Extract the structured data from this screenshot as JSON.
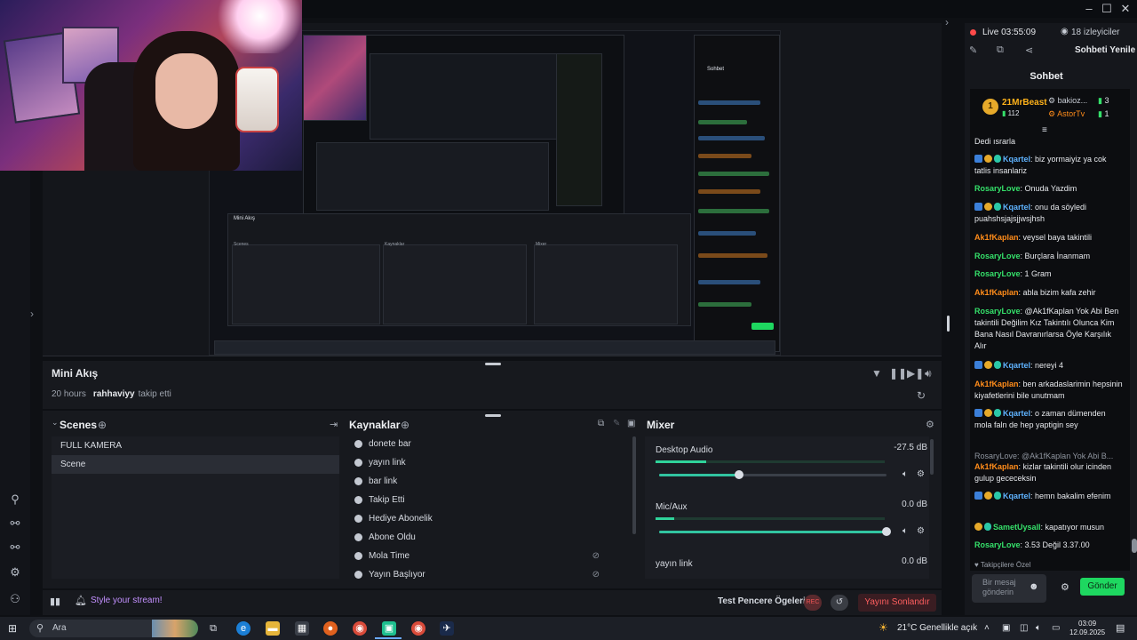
{
  "top": {
    "nav_arrow": "›",
    "win_buttons": [
      "–",
      "☐",
      "✕"
    ]
  },
  "left_rail_icons": [
    "chart-icon",
    "bell-icon",
    "link-icon",
    "link2-icon",
    "settings-icon",
    "user-icon"
  ],
  "mini_akis": {
    "title": "Mini Akış",
    "time": "20 hours",
    "user": "rahhaviyy",
    "event": "takip etti"
  },
  "scenes": {
    "title": "Scenes",
    "items": [
      "FULL KAMERA",
      "Scene"
    ],
    "selected_index": 1
  },
  "sources": {
    "title": "Kaynaklar",
    "items": [
      "donete bar",
      "yayın link",
      "bar link",
      "Takip Etti",
      "Hediye Abonelik",
      "Abone Oldu",
      "Mola Time",
      "Yayın Başlıyor"
    ],
    "hidden_indices": [
      6,
      7
    ]
  },
  "mixer": {
    "title": "Mixer",
    "channels": [
      {
        "name": "Desktop Audio",
        "db": "-27.5 dB",
        "level": 0.22,
        "volume": 0.35
      },
      {
        "name": "Mic/Aux",
        "db": "0.0 dB",
        "level": 0.08,
        "volume": 1.0
      },
      {
        "name": "yayın link",
        "db": "0.0 dB",
        "level": 0,
        "volume": 1.0
      }
    ]
  },
  "footer": {
    "style_label": "Style your stream!",
    "test_label": "Test Pencere Ögeleri",
    "rec_label": "REC",
    "end_label": "Yayını Sonlandır"
  },
  "stream": {
    "live_label": "Live 03:55:09",
    "viewers": "18 izleyiciler",
    "refresh_chat": "Sohbeti Yenile"
  },
  "chat": {
    "title": "Sohbet",
    "leaderboard": {
      "top_name": "21MrBeast",
      "top_badge": "1",
      "top_count": "112",
      "second_name": "bakioz...",
      "second_count": "3",
      "third_name": "AstorTv",
      "third_count": "1"
    },
    "colors": {
      "blue": "#5fb3ff",
      "green": "#35e06a",
      "orange": "#ff8c1a",
      "gray": "#8e949e"
    },
    "messages": [
      {
        "user": "",
        "text": "Dedi ısrarla",
        "color": "white",
        "badges": false
      },
      {
        "user": "Kqartel",
        "text": ": biz yormaiyiz ya cok tatlis insanlariz",
        "color": "blue",
        "badges": true
      },
      {
        "user": "RosaryLove",
        "text": ": Onuda Yazdim",
        "color": "green",
        "badges": false
      },
      {
        "user": "Kqartel",
        "text": ": onu da söyledi puahshsjajsjjwsjhsh",
        "color": "blue",
        "badges": true
      },
      {
        "user": "Ak1fKaplan",
        "text": ": veysel baya takintili",
        "color": "orange",
        "badges": false
      },
      {
        "user": "RosaryLove",
        "text": ": Burçlara İnanmam",
        "color": "green",
        "badges": false
      },
      {
        "user": "RosaryLove",
        "text": ": 1 Gram",
        "color": "green",
        "badges": false
      },
      {
        "user": "Ak1fKaplan",
        "text": ": abla bizim kafa zehir",
        "color": "orange",
        "badges": false
      },
      {
        "user": "RosaryLove",
        "text": ": @Ak1fKaplan Yok Abi Ben takintili Değilim Kız Takintılı Olunca Kim Bana Nasıl Davranırlarsa Öyle Karşılık Alır",
        "color": "green",
        "badges": false
      },
      {
        "user": "Kqartel",
        "text": ": nereyi 4",
        "color": "blue",
        "badges": true
      },
      {
        "user": "Ak1fKaplan",
        "text": ": ben arkadaslarimin hepsinin kiyafetlerini bile unutmam",
        "color": "orange",
        "badges": false
      },
      {
        "user": "Kqartel",
        "text": ": o zaman dümenden mola faln de hep yaptigin sey",
        "color": "blue",
        "badges": true
      },
      {
        "user": "",
        "text": "RosaryLove: @Ak1fKaplan Yok Abi B...",
        "color": "gray",
        "badges": false
      },
      {
        "user": "Ak1fKaplan",
        "text": ": kizlar takintili olur icinden gulup gececeksin",
        "color": "orange",
        "badges": false
      },
      {
        "user": "Kqartel",
        "text": ": hemn bakalim efenim",
        "color": "blue",
        "badges": true
      },
      {
        "user": "SametUysall",
        "text": ": kapatıyor musun",
        "color": "green",
        "badges": "teal"
      },
      {
        "user": "RosaryLove",
        "text": ": 3.53 Değil 3.37.00",
        "color": "green",
        "badges": false
      }
    ],
    "followers_only": "Takipçilere Özel",
    "input_placeholder": "Bir mesaj gönderin",
    "send_label": "Gönder"
  },
  "taskbar": {
    "search_label": "Ara",
    "weather": "21°C  Genellikle açık",
    "time": "03:09",
    "date": "12.09.2025"
  }
}
